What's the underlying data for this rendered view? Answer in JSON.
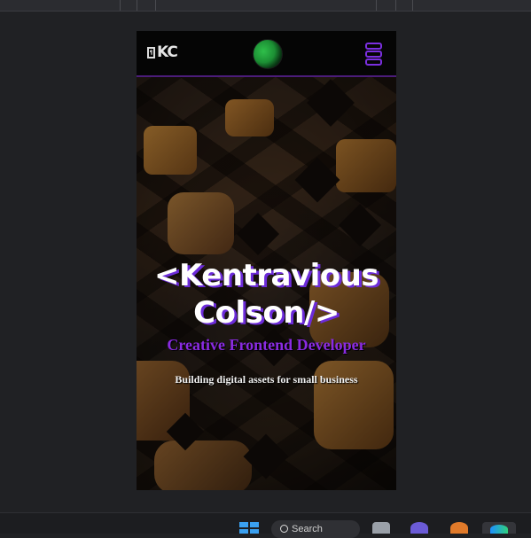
{
  "site": {
    "logo_box_text": "¶",
    "logo_text": "KC"
  },
  "hero": {
    "title": "<Kentravious Colson/>",
    "subtitle": "Creative Frontend Developer",
    "tagline": "Building digital assets for small business"
  },
  "taskbar": {
    "search_label": "Search"
  },
  "colors": {
    "accent": "#7b2fe0",
    "subtitle": "#8a2be2",
    "background": "#202124",
    "nav": "#050505"
  },
  "icons": [
    "menu-icon",
    "windows-start-icon",
    "search-icon",
    "taskbar-app-icon",
    "edge-browser-icon"
  ]
}
